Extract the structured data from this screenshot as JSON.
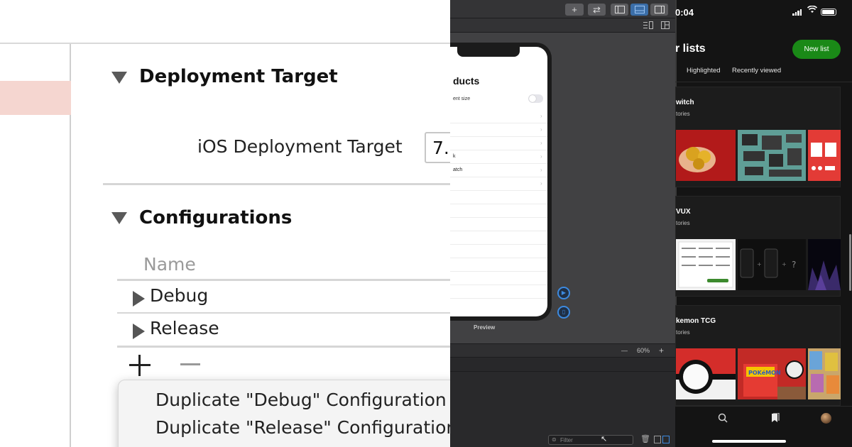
{
  "xcode_settings": {
    "deployment_section": "Deployment Target",
    "ios_target_label": "iOS Deployment Target",
    "ios_target_value": "7.",
    "configurations_section": "Configurations",
    "column_name": "Name",
    "configurations": [
      "Debug",
      "Release"
    ],
    "add_symbol": "+",
    "remove_symbol": "—",
    "menu_items": [
      "Duplicate \"Debug\" Configuration",
      "Duplicate \"Release\" Configuration"
    ]
  },
  "xcode_preview": {
    "toolbar_add": "+",
    "toolbar_swap": "⇄",
    "phone_title": "ducts",
    "phone_setting": "ent size",
    "phone_rows": [
      "",
      "",
      "",
      "k",
      "atch",
      ""
    ],
    "preview_label": "Preview",
    "zoom_out": "—",
    "zoom_level": "60%",
    "zoom_in": "+",
    "filter_placeholder": "Filter"
  },
  "medium_lists": {
    "time": "0:04",
    "title": "r lists",
    "new_list_button": "New list",
    "tabs": [
      "Highlighted",
      "Recently viewed"
    ],
    "lists": [
      {
        "name": "witch",
        "count": "tories"
      },
      {
        "name": "VUX",
        "count": "tories"
      },
      {
        "name": "kemon TCG",
        "count": "tories"
      }
    ],
    "colors": {
      "accent_green": "#1a8917",
      "background": "#141414"
    }
  }
}
